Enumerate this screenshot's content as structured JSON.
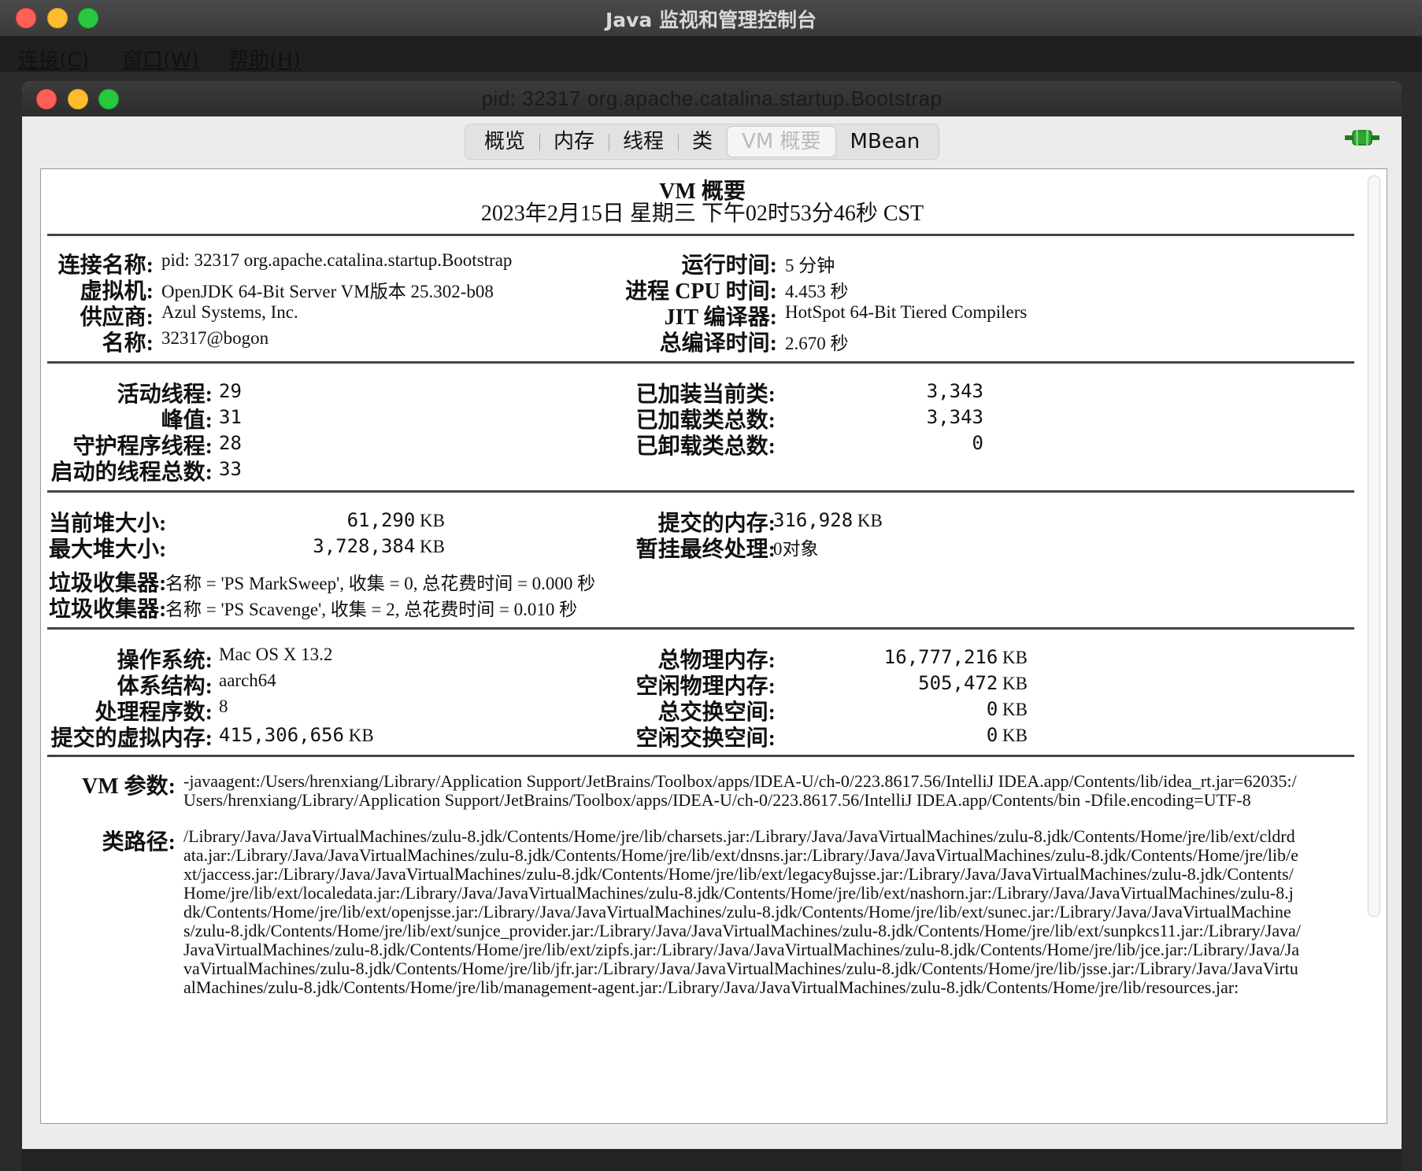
{
  "app": {
    "title": "Java 监视和管理控制台",
    "menus": [
      "连接(C)",
      "窗口(W)",
      "帮助(H)"
    ]
  },
  "window": {
    "title": "pid: 32317 org.apache.catalina.startup.Bootstrap"
  },
  "tabs": [
    {
      "label": "概览",
      "active": false
    },
    {
      "label": "内存",
      "active": false
    },
    {
      "label": "线程",
      "active": false
    },
    {
      "label": "类",
      "active": false
    },
    {
      "label": "VM 概要",
      "active": true
    },
    {
      "label": "MBean",
      "active": false
    }
  ],
  "summary": {
    "title": "VM 概要",
    "date": "2023年2月15日 星期三 下午02时53分46秒 CST",
    "connection": [
      {
        "label": "连接名称:",
        "value": "pid: 32317 org.apache.catalina.startup.Bootstrap"
      },
      {
        "label": "虚拟机:",
        "value": "OpenJDK 64-Bit Server VM版本 25.302-b08"
      },
      {
        "label": "供应商:",
        "value": "Azul Systems, Inc."
      },
      {
        "label": "名称:",
        "value": "32317@bogon"
      }
    ],
    "runtime": [
      {
        "label": "运行时间:",
        "value": "5 分钟"
      },
      {
        "label": "进程 CPU 时间:",
        "value": "4.453 秒"
      },
      {
        "label": "JIT 编译器:",
        "value": "HotSpot 64-Bit Tiered Compilers"
      },
      {
        "label": "总编译时间:",
        "value": "2.670 秒"
      }
    ],
    "threads": [
      {
        "label": "活动线程:",
        "value": "29"
      },
      {
        "label": "峰值:",
        "value": "31"
      },
      {
        "label": "守护程序线程:",
        "value": "28"
      },
      {
        "label": "启动的线程总数:",
        "value": "33"
      }
    ],
    "classes": [
      {
        "label": "已加装当前类:",
        "value": "3,343"
      },
      {
        "label": "已加载类总数:",
        "value": "3,343"
      },
      {
        "label": "已卸载类总数:",
        "value": "0"
      }
    ],
    "heap": [
      {
        "label": "当前堆大小:",
        "value": "61,290",
        "unit": "KB"
      },
      {
        "label": "最大堆大小:",
        "value": "3,728,384",
        "unit": "KB"
      }
    ],
    "memory_right": [
      {
        "label": "提交的内存:",
        "value": "316,928",
        "unit": "KB"
      },
      {
        "label": "暂挂最终处理:",
        "value": "0对象",
        "unit": ""
      }
    ],
    "gc": [
      {
        "label": "垃圾收集器:",
        "value": "名称 = 'PS MarkSweep', 收集 = 0, 总花费时间 = 0.000 秒"
      },
      {
        "label": "垃圾收集器:",
        "value": "名称 = 'PS Scavenge', 收集 = 2, 总花费时间 = 0.010 秒"
      }
    ],
    "os": [
      {
        "label": "操作系统:",
        "value": "Mac OS X 13.2",
        "unit": ""
      },
      {
        "label": "体系结构:",
        "value": "aarch64",
        "unit": ""
      },
      {
        "label": "处理程序数:",
        "value": "8",
        "unit": ""
      },
      {
        "label": "提交的虚拟内存:",
        "value": "415,306,656",
        "unit": "KB"
      }
    ],
    "physical": [
      {
        "label": "总物理内存:",
        "value": "16,777,216",
        "unit": "KB"
      },
      {
        "label": "空闲物理内存:",
        "value": "505,472",
        "unit": "KB"
      },
      {
        "label": "总交换空间:",
        "value": "0",
        "unit": "KB"
      },
      {
        "label": "空闲交换空间:",
        "value": "0",
        "unit": "KB"
      }
    ],
    "vm_args_label": "VM 参数:",
    "vm_args": "-javaagent:/Users/hrenxiang/Library/Application Support/JetBrains/Toolbox/apps/IDEA-U/ch-0/223.8617.56/IntelliJ IDEA.app/Contents/lib/idea_rt.jar=62035:/Users/hrenxiang/Library/Application Support/JetBrains/Toolbox/apps/IDEA-U/ch-0/223.8617.56/IntelliJ IDEA.app/Contents/bin -Dfile.encoding=UTF-8",
    "classpath_label": "类路径:",
    "classpath": "/Library/Java/JavaVirtualMachines/zulu-8.jdk/Contents/Home/jre/lib/charsets.jar:/Library/Java/JavaVirtualMachines/zulu-8.jdk/Contents/Home/jre/lib/ext/cldrdata.jar:/Library/Java/JavaVirtualMachines/zulu-8.jdk/Contents/Home/jre/lib/ext/dnsns.jar:/Library/Java/JavaVirtualMachines/zulu-8.jdk/Contents/Home/jre/lib/ext/jaccess.jar:/Library/Java/JavaVirtualMachines/zulu-8.jdk/Contents/Home/jre/lib/ext/legacy8ujsse.jar:/Library/Java/JavaVirtualMachines/zulu-8.jdk/Contents/Home/jre/lib/ext/localedata.jar:/Library/Java/JavaVirtualMachines/zulu-8.jdk/Contents/Home/jre/lib/ext/nashorn.jar:/Library/Java/JavaVirtualMachines/zulu-8.jdk/Contents/Home/jre/lib/ext/openjsse.jar:/Library/Java/JavaVirtualMachines/zulu-8.jdk/Contents/Home/jre/lib/ext/sunec.jar:/Library/Java/JavaVirtualMachines/zulu-8.jdk/Contents/Home/jre/lib/ext/sunjce_provider.jar:/Library/Java/JavaVirtualMachines/zulu-8.jdk/Contents/Home/jre/lib/ext/sunpkcs11.jar:/Library/Java/JavaVirtualMachines/zulu-8.jdk/Contents/Home/jre/lib/ext/zipfs.jar:/Library/Java/JavaVirtualMachines/zulu-8.jdk/Contents/Home/jre/lib/jce.jar:/Library/Java/JavaVirtualMachines/zulu-8.jdk/Contents/Home/jre/lib/jfr.jar:/Library/Java/JavaVirtualMachines/zulu-8.jdk/Contents/Home/jre/lib/jsse.jar:/Library/Java/JavaVirtualMachines/zulu-8.jdk/Contents/Home/jre/lib/management-agent.jar:/Library/Java/JavaVirtualMachines/zulu-8.jdk/Contents/Home/jre/lib/resources.jar:"
  },
  "icons": {
    "connection": "connection-plug-icon"
  },
  "colors": {
    "connection_icon": "#2fa52f",
    "close": "#fe5f57",
    "minimize": "#febc2e",
    "zoom": "#28c840"
  }
}
